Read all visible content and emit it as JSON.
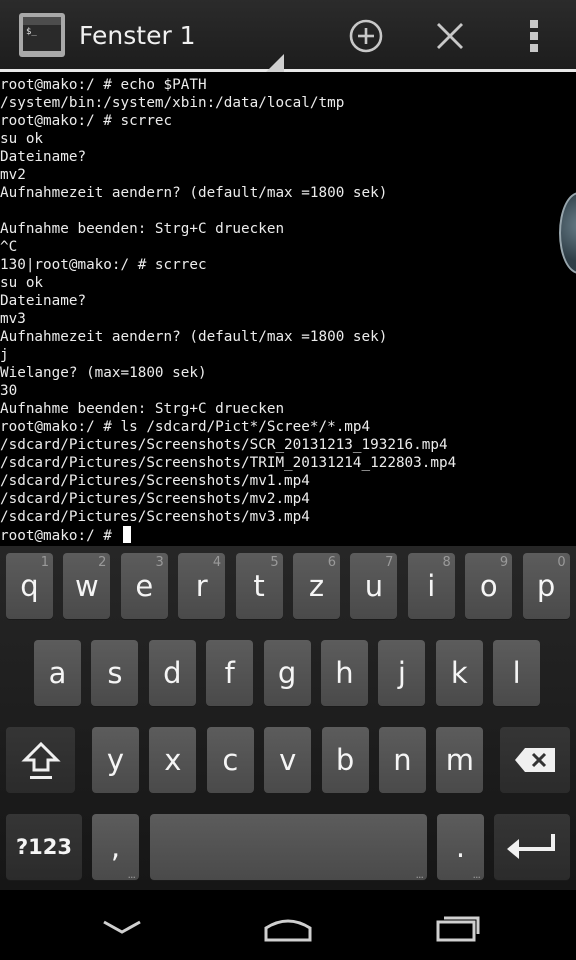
{
  "action_bar": {
    "app_icon": "terminal-icon",
    "window_title": "Fenster 1",
    "buttons": [
      {
        "name": "new-window-button",
        "icon": "plus-circle-icon"
      },
      {
        "name": "close-window-button",
        "icon": "close-icon"
      },
      {
        "name": "overflow-menu-button",
        "icon": "more-vert-icon"
      }
    ]
  },
  "terminal": {
    "lines": [
      "root@mako:/ # echo $PATH",
      "/system/bin:/system/xbin:/data/local/tmp",
      "root@mako:/ # scrrec",
      "su ok",
      "Dateiname?",
      "mv2",
      "Aufnahmezeit aendern? (default/max =1800 sek)",
      "",
      "Aufnahme beenden: Strg+C druecken",
      "^C",
      "130|root@mako:/ # scrrec",
      "su ok",
      "Dateiname?",
      "mv3",
      "Aufnahmezeit aendern? (default/max =1800 sek)",
      "j",
      "Wielange? (max=1800 sek)",
      "30",
      "Aufnahme beenden: Strg+C druecken",
      "root@mako:/ # ls /sdcard/Pict*/Scree*/*.mp4",
      "/sdcard/Pictures/Screenshots/SCR_20131213_193216.mp4",
      "/sdcard/Pictures/Screenshots/TRIM_20131214_122803.mp4",
      "/sdcard/Pictures/Screenshots/mv1.mp4",
      "/sdcard/Pictures/Screenshots/mv2.mp4",
      "/sdcard/Pictures/Screenshots/mv3.mp4"
    ],
    "prompt": "root@mako:/ # "
  },
  "keyboard": {
    "row1": [
      {
        "label": "q",
        "hint": "1"
      },
      {
        "label": "w",
        "hint": "2"
      },
      {
        "label": "e",
        "hint": "3"
      },
      {
        "label": "r",
        "hint": "4"
      },
      {
        "label": "t",
        "hint": "5"
      },
      {
        "label": "z",
        "hint": "6"
      },
      {
        "label": "u",
        "hint": "7"
      },
      {
        "label": "i",
        "hint": "8"
      },
      {
        "label": "o",
        "hint": "9"
      },
      {
        "label": "p",
        "hint": "0"
      }
    ],
    "row2": [
      "a",
      "s",
      "d",
      "f",
      "g",
      "h",
      "j",
      "k",
      "l"
    ],
    "row3": [
      "y",
      "x",
      "c",
      "v",
      "b",
      "n",
      "m"
    ],
    "symbols_label": "?123",
    "comma_label": ",",
    "period_label": ".",
    "more_dots": "..."
  },
  "navbar": {
    "buttons": [
      "back-icon",
      "home-icon",
      "recents-icon"
    ]
  },
  "colors": {
    "terminal_bg": "#000000",
    "terminal_fg": "#ececec",
    "key_bg": "#545454",
    "keyboard_bg": "#1e1e1e"
  }
}
